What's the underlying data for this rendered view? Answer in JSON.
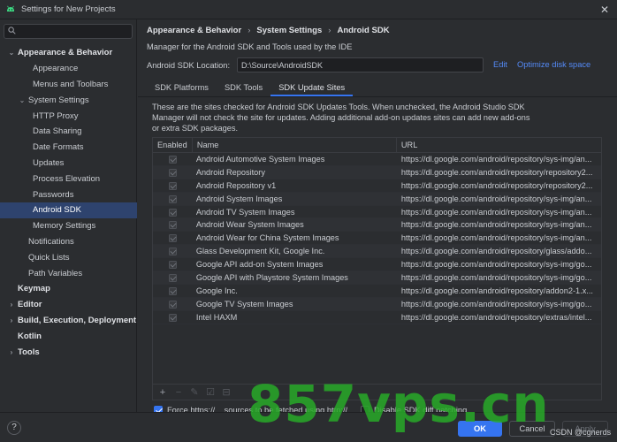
{
  "window": {
    "title": "Settings for New Projects",
    "close_glyph": "✕"
  },
  "sidebar": {
    "search_value": "",
    "items": [
      {
        "label": "Appearance & Behavior",
        "level": 0,
        "bold": true,
        "expanded": true
      },
      {
        "label": "Appearance",
        "level": 2
      },
      {
        "label": "Menus and Toolbars",
        "level": 2
      },
      {
        "label": "System Settings",
        "level": 1,
        "expanded": true
      },
      {
        "label": "HTTP Proxy",
        "level": 2
      },
      {
        "label": "Data Sharing",
        "level": 2
      },
      {
        "label": "Date Formats",
        "level": 2
      },
      {
        "label": "Updates",
        "level": 2
      },
      {
        "label": "Process Elevation",
        "level": 2
      },
      {
        "label": "Passwords",
        "level": 2
      },
      {
        "label": "Android SDK",
        "level": 2,
        "selected": true
      },
      {
        "label": "Memory Settings",
        "level": 2
      },
      {
        "label": "Notifications",
        "level": 1
      },
      {
        "label": "Quick Lists",
        "level": 1
      },
      {
        "label": "Path Variables",
        "level": 1
      },
      {
        "label": "Keymap",
        "level": 0,
        "bold": true
      },
      {
        "label": "Editor",
        "level": 0,
        "bold": true,
        "expandable": true
      },
      {
        "label": "Build, Execution, Deployment",
        "level": 0,
        "bold": true,
        "expandable": true
      },
      {
        "label": "Kotlin",
        "level": 0,
        "bold": true
      },
      {
        "label": "Tools",
        "level": 0,
        "bold": true,
        "expandable": true
      }
    ]
  },
  "breadcrumb": {
    "items": [
      "Appearance & Behavior",
      "System Settings",
      "Android SDK"
    ],
    "sep": "›"
  },
  "main": {
    "description": "Manager for the Android SDK and Tools used by the IDE",
    "location_label": "Android SDK Location:",
    "location_value": "D:\\Source\\AndroidSDK",
    "edit_link": "Edit",
    "optimize_link": "Optimize disk space",
    "tabs": [
      "SDK Platforms",
      "SDK Tools",
      "SDK Update Sites"
    ],
    "active_tab": 2,
    "sites_description": "These are the sites checked for Android SDK Updates Tools. When unchecked, the Android Studio SDK Manager will not check the site for updates. Adding additional add-on updates sites can add new add-ons or extra SDK packages."
  },
  "table": {
    "headers": [
      "Enabled",
      "Name",
      "URL"
    ],
    "rows": [
      {
        "name": "Android Automotive System Images",
        "url": "https://dl.google.com/android/repository/sys-img/an..."
      },
      {
        "name": "Android Repository",
        "url": "https://dl.google.com/android/repository/repository2..."
      },
      {
        "name": "Android Repository v1",
        "url": "https://dl.google.com/android/repository/repository2..."
      },
      {
        "name": "Android System Images",
        "url": "https://dl.google.com/android/repository/sys-img/an..."
      },
      {
        "name": "Android TV System Images",
        "url": "https://dl.google.com/android/repository/sys-img/an..."
      },
      {
        "name": "Android Wear System Images",
        "url": "https://dl.google.com/android/repository/sys-img/an..."
      },
      {
        "name": "Android Wear for China System Images",
        "url": "https://dl.google.com/android/repository/sys-img/an..."
      },
      {
        "name": "Glass Development Kit, Google Inc.",
        "url": "https://dl.google.com/android/repository/glass/addo..."
      },
      {
        "name": "Google API add-on System Images",
        "url": "https://dl.google.com/android/repository/sys-img/go..."
      },
      {
        "name": "Google API with Playstore System Images",
        "url": "https://dl.google.com/android/repository/sys-img/go..."
      },
      {
        "name": "Google Inc.",
        "url": "https://dl.google.com/android/repository/addon2-1.x..."
      },
      {
        "name": "Google TV System Images",
        "url": "https://dl.google.com/android/repository/sys-img/go..."
      },
      {
        "name": "Intel HAXM",
        "url": "https://dl.google.com/android/repository/extras/intel..."
      }
    ],
    "toolbar": {
      "add": "+",
      "remove": "−",
      "edit": "✎",
      "check": "☑",
      "uncheck": "⊟"
    }
  },
  "options": {
    "force_https": "Force https://... sources to be fetched using http://...",
    "force_https_checked": true,
    "disable_diff": "Disable SDK diff patching",
    "disable_diff_checked": false
  },
  "footer": {
    "ok": "OK",
    "cancel": "Cancel",
    "apply": "Apply",
    "help": "?"
  },
  "overlay": {
    "credit": "CSDN @cgnerds",
    "watermark": "857vps.cn"
  },
  "colors": {
    "accent": "#3574f0",
    "selected": "#2e436e",
    "link": "#548af7",
    "background": "#2b2d30"
  }
}
